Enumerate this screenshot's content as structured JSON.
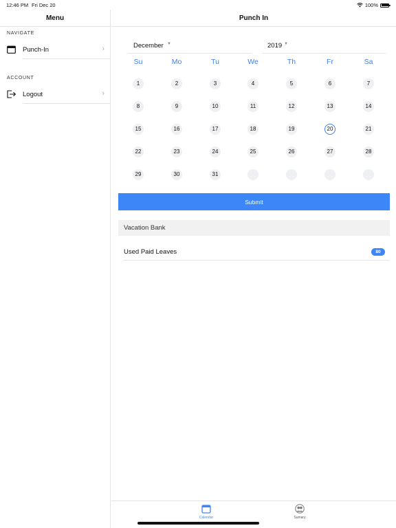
{
  "status_bar": {
    "time": "12:46 PM",
    "date": "Fri Dec 20",
    "battery": "100%"
  },
  "sidebar": {
    "title": "Menu",
    "sections": [
      {
        "label": "NAVIGATE",
        "items": [
          {
            "label": "Punch-In",
            "icon": "calendar-icon"
          }
        ]
      },
      {
        "label": "ACCOUNT",
        "items": [
          {
            "label": "Logout",
            "icon": "logout-icon"
          }
        ]
      }
    ]
  },
  "main": {
    "title": "Punch In",
    "month_select": "December",
    "year_select": "2019",
    "weekdays": [
      "Su",
      "Mo",
      "Tu",
      "We",
      "Th",
      "Fr",
      "Sa"
    ],
    "days": [
      "1",
      "2",
      "3",
      "4",
      "5",
      "6",
      "7",
      "8",
      "9",
      "10",
      "11",
      "12",
      "13",
      "14",
      "15",
      "16",
      "17",
      "18",
      "19",
      "20",
      "21",
      "22",
      "23",
      "24",
      "25",
      "26",
      "27",
      "28",
      "29",
      "30",
      "31"
    ],
    "selected_day": "20",
    "submit_label": "Submit",
    "vacation_bank_label": "Vacation Bank",
    "used_paid_leaves_label": "Used Paid Leaves",
    "used_paid_leaves_count": "80"
  },
  "tab_bar": {
    "tabs": [
      {
        "label": "Calendar",
        "icon": "calendar-icon",
        "active": true
      },
      {
        "label": "Sumary",
        "icon": "people-icon",
        "active": false
      }
    ]
  },
  "colors": {
    "accent": "#3d86f7",
    "weekday": "#3d7fe6",
    "day_bg": "#f0f0f3"
  }
}
